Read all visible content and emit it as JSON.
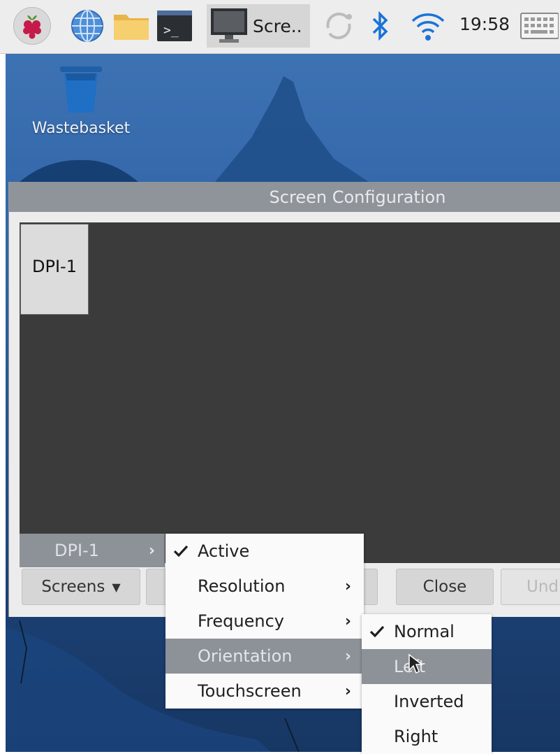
{
  "taskbar": {
    "task_label": "Scre..",
    "clock": "19:58",
    "icons": [
      "raspberry-pi-menu-icon",
      "web-browser-icon",
      "file-manager-icon",
      "terminal-icon",
      "display-icon",
      "updater-icon",
      "bluetooth-icon",
      "wifi-icon",
      "keyboard-icon"
    ]
  },
  "desktop": {
    "wastebasket_label": "Wastebasket"
  },
  "window": {
    "title": "Screen Configuration",
    "monitor_label": "DPI-1",
    "buttons": {
      "screens": "Screens",
      "close": "Close",
      "undo": "Und"
    }
  },
  "menus": {
    "screens_menu": {
      "item": "DPI-1"
    },
    "dpi1_menu": {
      "items": [
        {
          "label": "Active",
          "checked": true,
          "submenu": false
        },
        {
          "label": "Resolution",
          "checked": false,
          "submenu": true
        },
        {
          "label": "Frequency",
          "checked": false,
          "submenu": true
        },
        {
          "label": "Orientation",
          "checked": false,
          "submenu": true,
          "highlighted": true
        },
        {
          "label": "Touchscreen",
          "checked": false,
          "submenu": true
        }
      ]
    },
    "orientation_menu": {
      "items": [
        {
          "label": "Normal",
          "checked": true
        },
        {
          "label": "Left",
          "highlighted": true
        },
        {
          "label": "Inverted"
        },
        {
          "label": "Right"
        }
      ]
    }
  },
  "colors": {
    "panel_bg": "#ededed",
    "desktop_blue": "#2f63a6",
    "menu_highlight": "#8d9299",
    "canvas_bg": "#3b3b3b",
    "bluetooth_blue": "#1a73d8",
    "wifi_blue": "#1a73d8"
  }
}
